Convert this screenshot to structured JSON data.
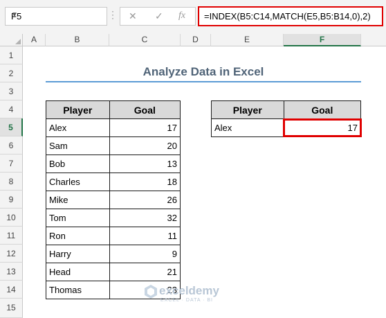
{
  "toolbar": {
    "name_box": "F5",
    "cancel_icon": "✕",
    "enter_icon": "✓",
    "fx_label": "fx",
    "formula": "=INDEX(B5:C14,MATCH(E5,B5:B14,0),2)"
  },
  "columns": [
    "A",
    "B",
    "C",
    "D",
    "E",
    "F"
  ],
  "rows": [
    "1",
    "2",
    "3",
    "4",
    "5",
    "6",
    "7",
    "8",
    "9",
    "10",
    "11",
    "12",
    "13",
    "14",
    "15"
  ],
  "selected_cell": "F5",
  "title": "Analyze Data in Excel",
  "data_table": {
    "headers": [
      "Player",
      "Goal"
    ],
    "rows": [
      {
        "player": "Alex",
        "goal": "17"
      },
      {
        "player": "Sam",
        "goal": "20"
      },
      {
        "player": "Bob",
        "goal": "13"
      },
      {
        "player": "Charles",
        "goal": "18"
      },
      {
        "player": "Mike",
        "goal": "26"
      },
      {
        "player": "Tom",
        "goal": "32"
      },
      {
        "player": "Ron",
        "goal": "11"
      },
      {
        "player": "Harry",
        "goal": "9"
      },
      {
        "player": "Head",
        "goal": "21"
      },
      {
        "player": "Thomas",
        "goal": "23"
      }
    ]
  },
  "lookup_table": {
    "headers": [
      "Player",
      "Goal"
    ],
    "row": {
      "player": "Alex",
      "goal": "17"
    }
  },
  "watermark": {
    "name": "exceldemy",
    "tagline": "EXCEL · DATA · BI"
  },
  "colors": {
    "highlight": "#e00000",
    "title": "#4f6377",
    "accent_line": "#5b9bd5",
    "header_fill": "#d9d9d9"
  }
}
